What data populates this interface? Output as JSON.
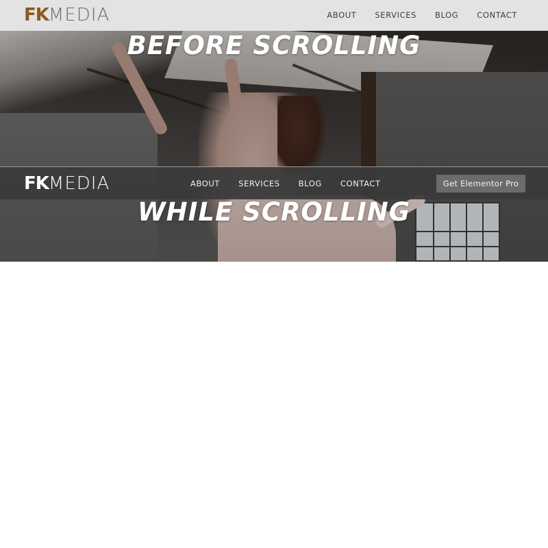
{
  "brand": {
    "logo_bold": "FK",
    "logo_light": "MEDIA"
  },
  "top_nav": {
    "items": [
      {
        "label": "ABOUT"
      },
      {
        "label": "SERVICES"
      },
      {
        "label": "BLOG"
      },
      {
        "label": "CONTACT"
      }
    ]
  },
  "hero": {
    "before_heading": "BEFORE SCROLLING",
    "while_heading": "WHILE SCROLLING"
  },
  "sticky_nav": {
    "items": [
      {
        "label": "ABOUT"
      },
      {
        "label": "SERVICES"
      },
      {
        "label": "BLOG"
      },
      {
        "label": "CONTACT"
      }
    ],
    "cta_label": "Get Elementor Pro"
  },
  "colors": {
    "top_header_bg": "#e3e3e3",
    "logo_accent": "#8c5a1e",
    "sticky_header_bg": "#3a3a3a",
    "cta_bg": "#6b6b6b"
  }
}
